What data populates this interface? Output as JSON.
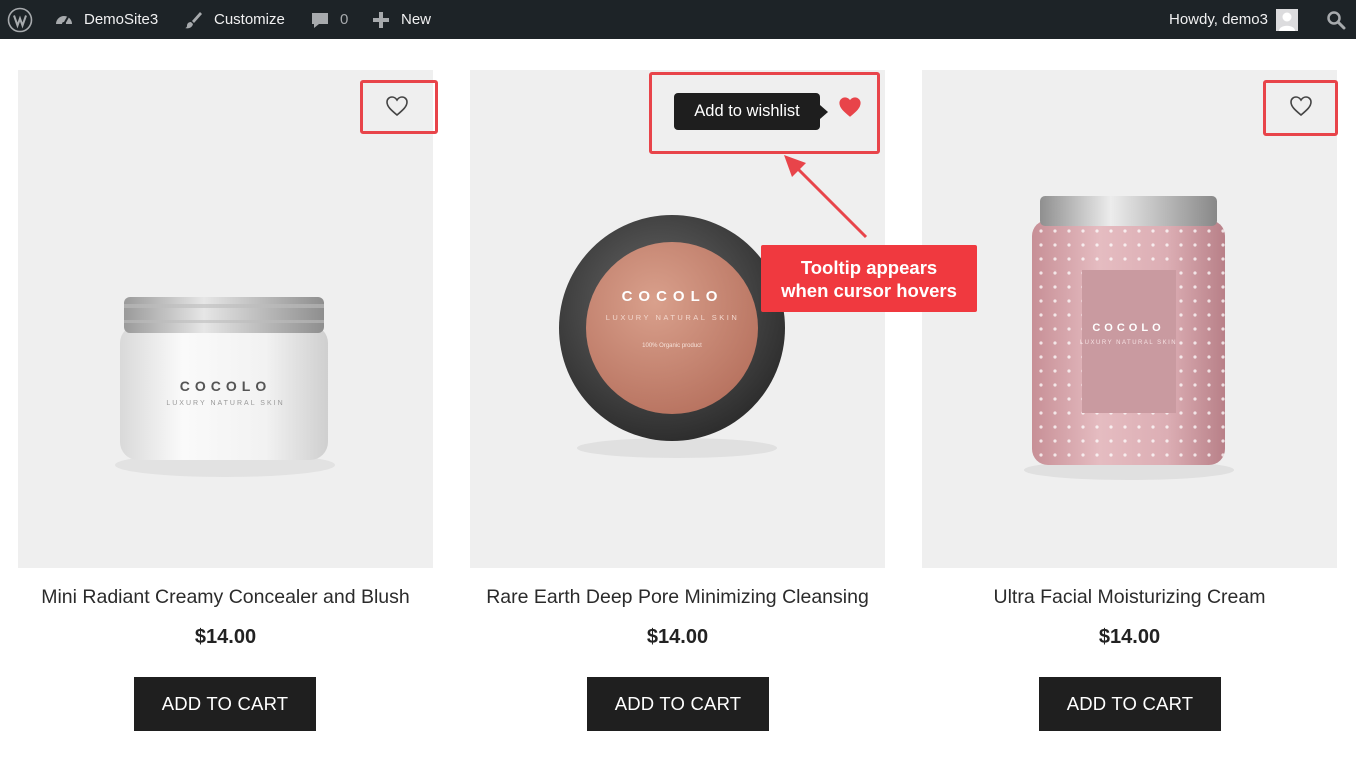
{
  "adminbar": {
    "site_name": "DemoSite3",
    "customize": "Customize",
    "comments_count": "0",
    "new": "New",
    "greeting": "Howdy, demo3",
    "icons": [
      "wordpress-icon",
      "dashboard-icon",
      "brush-icon",
      "comment-icon",
      "plus-icon",
      "avatar",
      "search-icon"
    ]
  },
  "products": [
    {
      "title": "Mini Radiant Creamy Concealer and Blush",
      "price": "$14.00",
      "cart_label": "ADD TO CART",
      "brand": "COCOLO",
      "tagline": "LUXURY NATURAL SKIN",
      "wishlisted": false
    },
    {
      "title": "Rare Earth Deep Pore Minimizing Cleansing",
      "price": "$14.00",
      "cart_label": "ADD TO CART",
      "brand": "COCOLO",
      "tagline": "LUXURY NATURAL SKIN",
      "organic": "100% Organic product",
      "wishlisted": true
    },
    {
      "title": "Ultra Facial Moisturizing Cream",
      "price": "$14.00",
      "cart_label": "ADD TO CART",
      "brand": "COCOLO",
      "tagline": "LUXURY NATURAL SKIN",
      "wishlisted": false
    }
  ],
  "tooltip": "Add to wishlist",
  "callout": {
    "line1": "Tooltip appears",
    "line2": "when cursor hovers"
  },
  "colors": {
    "adminbar": "#1d2327",
    "highlight": "#e8444a",
    "callout": "#f0393f",
    "heart_filled": "#e8444a",
    "button": "#1f1f1f"
  }
}
